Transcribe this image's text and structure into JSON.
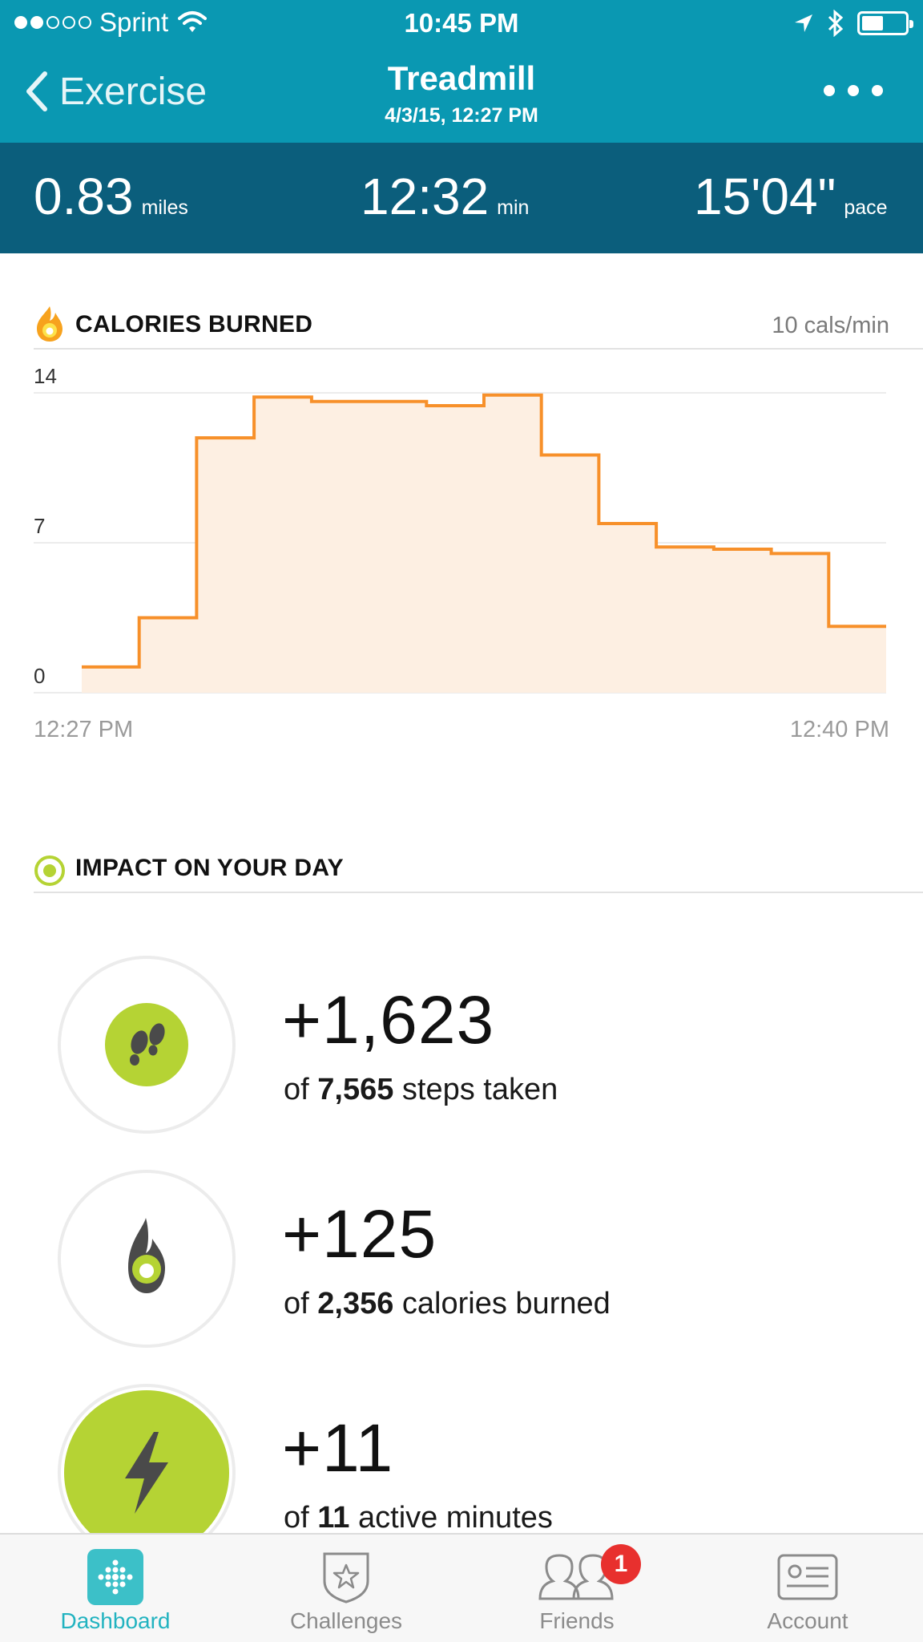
{
  "status_bar": {
    "carrier": "Sprint",
    "time": "10:45 PM",
    "battery_level": 0.5
  },
  "nav": {
    "back_label": "Exercise",
    "title": "Treadmill",
    "subtitle": "4/3/15, 12:27 PM"
  },
  "stats": [
    {
      "value": "0.83",
      "unit": "miles"
    },
    {
      "value": "12:32",
      "unit": "min"
    },
    {
      "value": "15'04\"",
      "unit": "pace"
    }
  ],
  "calories_section": {
    "title": "CALORIES BURNED",
    "rate": "10 cals/min"
  },
  "chart_data": {
    "type": "area",
    "step": true,
    "x_start_label": "12:27 PM",
    "x_end_label": "12:40 PM",
    "y_ticks": [
      "14",
      "7",
      "0"
    ],
    "ylim": [
      0,
      14
    ],
    "grid": true,
    "minutes": [
      0,
      1,
      2,
      3,
      4,
      5,
      6,
      7,
      8,
      9,
      10,
      11,
      12,
      13
    ],
    "values": [
      1.2,
      3.5,
      11.9,
      13.8,
      13.6,
      13.6,
      13.4,
      13.9,
      11.1,
      7.9,
      6.8,
      6.7,
      6.5,
      3.1
    ],
    "line_color": "#f7902a",
    "fill_color": "#fdefe2"
  },
  "impact_section": {
    "title": "IMPACT ON YOUR DAY"
  },
  "impact_items": [
    {
      "value": "+1,623",
      "prefix": "of",
      "total": "7,565",
      "suffix": "steps taken",
      "icon": "footsteps-icon"
    },
    {
      "value": "+125",
      "prefix": "of",
      "total": "2,356",
      "suffix": "calories burned",
      "icon": "flame-icon"
    },
    {
      "value": "+11",
      "prefix": "of",
      "total": "11",
      "suffix": "active minutes",
      "icon": "lightning-icon"
    }
  ],
  "tabs": [
    {
      "label": "Dashboard",
      "icon": "dashboard-icon",
      "active": true
    },
    {
      "label": "Challenges",
      "icon": "challenges-star-icon",
      "active": false
    },
    {
      "label": "Friends",
      "icon": "friends-icon",
      "active": false,
      "badge": "1"
    },
    {
      "label": "Account",
      "icon": "account-card-icon",
      "active": false
    }
  ],
  "colors": {
    "nav_teal": "#0a98b2",
    "stats_dark_teal": "#0b5e7c",
    "accent_green": "#b5d334",
    "chart_orange": "#f7902a",
    "active_tab": "#22b3c0",
    "badge_red": "#e8302e"
  }
}
